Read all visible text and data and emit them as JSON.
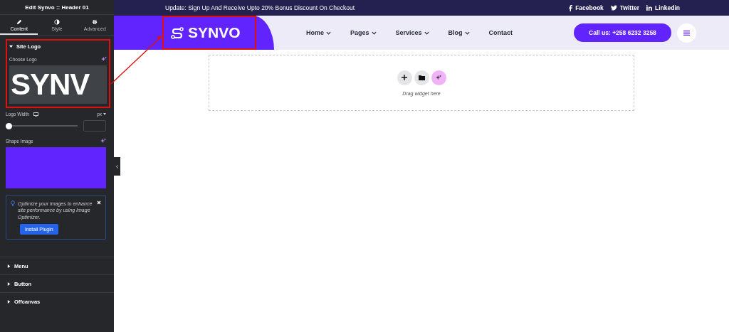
{
  "panel": {
    "title": "Edit Synvo :: Header 01",
    "tabs": [
      {
        "label": "Content",
        "selected": true
      },
      {
        "label": "Style",
        "selected": false
      },
      {
        "label": "Advanced",
        "selected": false
      }
    ],
    "section": {
      "title": "Site Logo",
      "expanded": true,
      "choose_logo": {
        "label": "Choose Logo",
        "preview_text": "SYNV"
      },
      "logo_width": {
        "label": "Logo Width",
        "unit": "px",
        "level": 0
      },
      "shape_image": {
        "label": "Shape Image"
      },
      "notice": {
        "text": "Optimize your images to enhance site performance by using Image Optimizer.",
        "button": "Install Plugin"
      }
    },
    "sections": [
      {
        "title": "Menu",
        "expanded": false
      },
      {
        "title": "Button",
        "expanded": false
      },
      {
        "title": "Offcanvas",
        "expanded": false
      }
    ]
  },
  "site": {
    "topbar": {
      "text": "Update: Sign Up And Receive Upto 20% Bonus Discount On Checkout",
      "social": [
        {
          "kind": "facebook",
          "label": "Facebook"
        },
        {
          "kind": "twitter",
          "label": "Twitter"
        },
        {
          "kind": "linkedin",
          "label": "Linkedin"
        }
      ]
    },
    "logo": "SYNVO",
    "nav": [
      {
        "label": "Home",
        "dropdown": true
      },
      {
        "label": "Pages",
        "dropdown": true
      },
      {
        "label": "Services",
        "dropdown": true
      },
      {
        "label": "Blog",
        "dropdown": true
      },
      {
        "label": "Contact",
        "dropdown": false
      }
    ],
    "cta": "Call us: +258 6232 3258",
    "dropzone": {
      "hint": "Drag widget here"
    }
  }
}
